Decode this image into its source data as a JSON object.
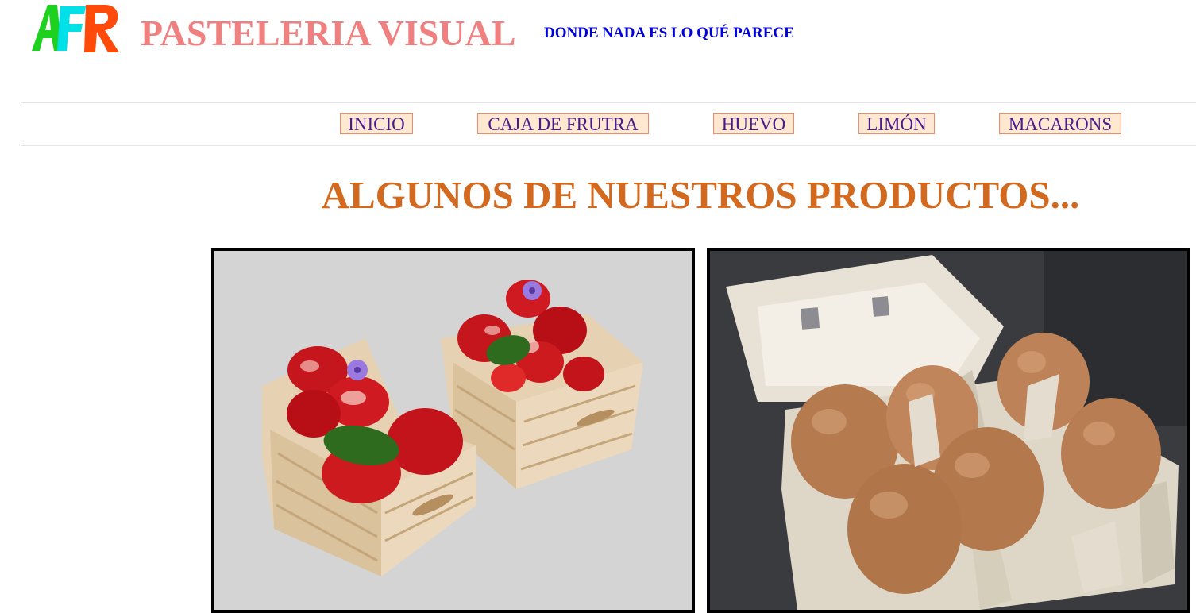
{
  "header": {
    "logo_text": "AFR",
    "title": "PASTELERIA VISUAL",
    "tagline": "DONDE NADA ES LO QUÉ PARECE"
  },
  "nav": {
    "items": [
      {
        "label": "INICIO"
      },
      {
        "label": "CAJA DE FRUTRA"
      },
      {
        "label": "HUEVO"
      },
      {
        "label": "LIMÓN"
      },
      {
        "label": "MACARONS"
      }
    ]
  },
  "main": {
    "heading": "ALGUNOS DE NUESTROS PRODUCTOS...",
    "products": [
      {
        "image": "strawberry-crates-photo"
      },
      {
        "image": "egg-carton-photo"
      }
    ]
  },
  "colors": {
    "title": "#f08080",
    "tagline": "#0000dd",
    "heading": "#d2691e",
    "nav_text": "#4b1a8c",
    "nav_bg": "#ffe8d2",
    "nav_border": "#f08a6a"
  }
}
